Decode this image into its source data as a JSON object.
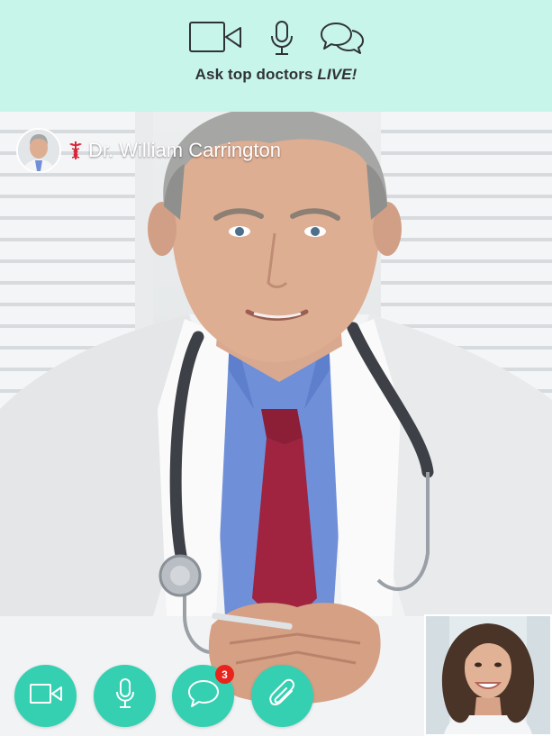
{
  "header": {
    "tagline_prefix": "Ask top doctors ",
    "tagline_emphasis": "LIVE!",
    "icons": [
      "video-camera-icon",
      "microphone-icon",
      "chat-bubbles-icon"
    ],
    "background_color": "#c8f5ea"
  },
  "call": {
    "doctor_name": "Dr. William Carrington",
    "doctor_badge_icon": "caduceus-icon"
  },
  "controls": {
    "buttons": [
      "video-camera-icon",
      "microphone-icon",
      "chat-bubble-icon",
      "paperclip-icon"
    ],
    "chat_unread_count": "3",
    "accent_color": "#35d0b1",
    "badge_color": "#e8241c"
  }
}
